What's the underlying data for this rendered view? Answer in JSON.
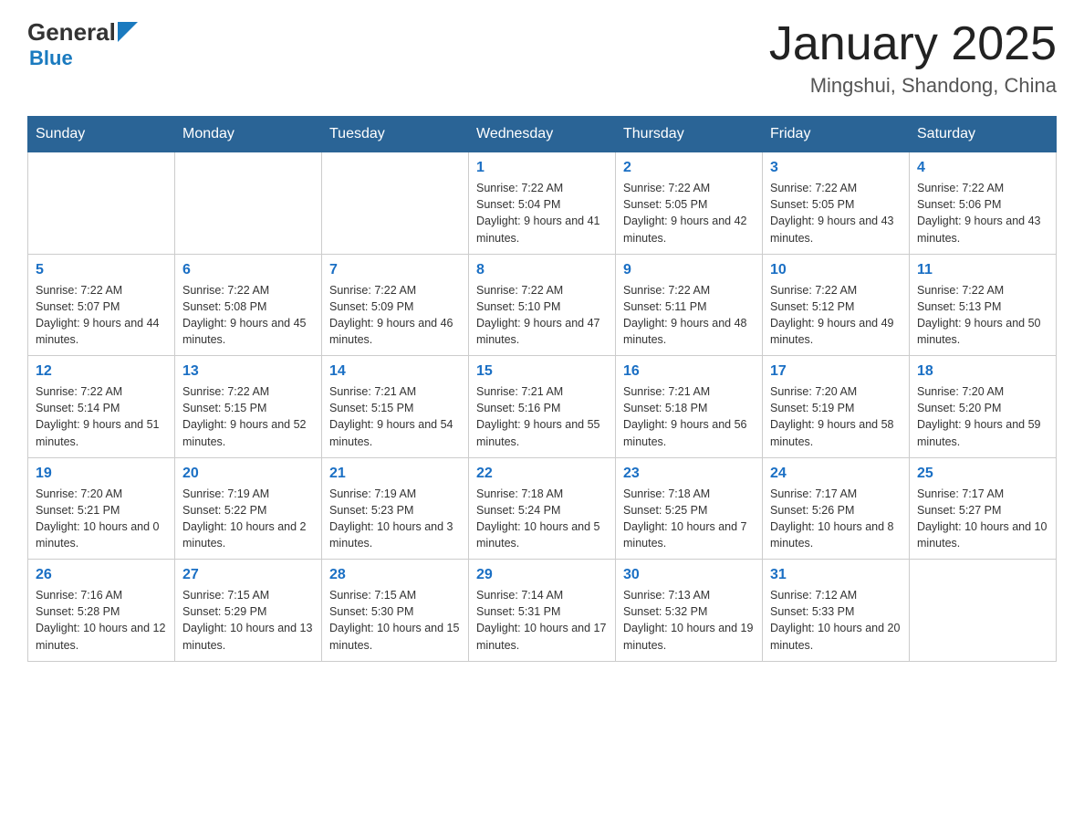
{
  "logo": {
    "general": "General",
    "blue": "Blue",
    "line2": "Blue"
  },
  "header": {
    "title": "January 2025",
    "subtitle": "Mingshui, Shandong, China"
  },
  "days_of_week": [
    "Sunday",
    "Monday",
    "Tuesday",
    "Wednesday",
    "Thursday",
    "Friday",
    "Saturday"
  ],
  "weeks": [
    [
      {
        "day": "",
        "info": ""
      },
      {
        "day": "",
        "info": ""
      },
      {
        "day": "",
        "info": ""
      },
      {
        "day": "1",
        "info": "Sunrise: 7:22 AM\nSunset: 5:04 PM\nDaylight: 9 hours and 41 minutes."
      },
      {
        "day": "2",
        "info": "Sunrise: 7:22 AM\nSunset: 5:05 PM\nDaylight: 9 hours and 42 minutes."
      },
      {
        "day": "3",
        "info": "Sunrise: 7:22 AM\nSunset: 5:05 PM\nDaylight: 9 hours and 43 minutes."
      },
      {
        "day": "4",
        "info": "Sunrise: 7:22 AM\nSunset: 5:06 PM\nDaylight: 9 hours and 43 minutes."
      }
    ],
    [
      {
        "day": "5",
        "info": "Sunrise: 7:22 AM\nSunset: 5:07 PM\nDaylight: 9 hours and 44 minutes."
      },
      {
        "day": "6",
        "info": "Sunrise: 7:22 AM\nSunset: 5:08 PM\nDaylight: 9 hours and 45 minutes."
      },
      {
        "day": "7",
        "info": "Sunrise: 7:22 AM\nSunset: 5:09 PM\nDaylight: 9 hours and 46 minutes."
      },
      {
        "day": "8",
        "info": "Sunrise: 7:22 AM\nSunset: 5:10 PM\nDaylight: 9 hours and 47 minutes."
      },
      {
        "day": "9",
        "info": "Sunrise: 7:22 AM\nSunset: 5:11 PM\nDaylight: 9 hours and 48 minutes."
      },
      {
        "day": "10",
        "info": "Sunrise: 7:22 AM\nSunset: 5:12 PM\nDaylight: 9 hours and 49 minutes."
      },
      {
        "day": "11",
        "info": "Sunrise: 7:22 AM\nSunset: 5:13 PM\nDaylight: 9 hours and 50 minutes."
      }
    ],
    [
      {
        "day": "12",
        "info": "Sunrise: 7:22 AM\nSunset: 5:14 PM\nDaylight: 9 hours and 51 minutes."
      },
      {
        "day": "13",
        "info": "Sunrise: 7:22 AM\nSunset: 5:15 PM\nDaylight: 9 hours and 52 minutes."
      },
      {
        "day": "14",
        "info": "Sunrise: 7:21 AM\nSunset: 5:15 PM\nDaylight: 9 hours and 54 minutes."
      },
      {
        "day": "15",
        "info": "Sunrise: 7:21 AM\nSunset: 5:16 PM\nDaylight: 9 hours and 55 minutes."
      },
      {
        "day": "16",
        "info": "Sunrise: 7:21 AM\nSunset: 5:18 PM\nDaylight: 9 hours and 56 minutes."
      },
      {
        "day": "17",
        "info": "Sunrise: 7:20 AM\nSunset: 5:19 PM\nDaylight: 9 hours and 58 minutes."
      },
      {
        "day": "18",
        "info": "Sunrise: 7:20 AM\nSunset: 5:20 PM\nDaylight: 9 hours and 59 minutes."
      }
    ],
    [
      {
        "day": "19",
        "info": "Sunrise: 7:20 AM\nSunset: 5:21 PM\nDaylight: 10 hours and 0 minutes."
      },
      {
        "day": "20",
        "info": "Sunrise: 7:19 AM\nSunset: 5:22 PM\nDaylight: 10 hours and 2 minutes."
      },
      {
        "day": "21",
        "info": "Sunrise: 7:19 AM\nSunset: 5:23 PM\nDaylight: 10 hours and 3 minutes."
      },
      {
        "day": "22",
        "info": "Sunrise: 7:18 AM\nSunset: 5:24 PM\nDaylight: 10 hours and 5 minutes."
      },
      {
        "day": "23",
        "info": "Sunrise: 7:18 AM\nSunset: 5:25 PM\nDaylight: 10 hours and 7 minutes."
      },
      {
        "day": "24",
        "info": "Sunrise: 7:17 AM\nSunset: 5:26 PM\nDaylight: 10 hours and 8 minutes."
      },
      {
        "day": "25",
        "info": "Sunrise: 7:17 AM\nSunset: 5:27 PM\nDaylight: 10 hours and 10 minutes."
      }
    ],
    [
      {
        "day": "26",
        "info": "Sunrise: 7:16 AM\nSunset: 5:28 PM\nDaylight: 10 hours and 12 minutes."
      },
      {
        "day": "27",
        "info": "Sunrise: 7:15 AM\nSunset: 5:29 PM\nDaylight: 10 hours and 13 minutes."
      },
      {
        "day": "28",
        "info": "Sunrise: 7:15 AM\nSunset: 5:30 PM\nDaylight: 10 hours and 15 minutes."
      },
      {
        "day": "29",
        "info": "Sunrise: 7:14 AM\nSunset: 5:31 PM\nDaylight: 10 hours and 17 minutes."
      },
      {
        "day": "30",
        "info": "Sunrise: 7:13 AM\nSunset: 5:32 PM\nDaylight: 10 hours and 19 minutes."
      },
      {
        "day": "31",
        "info": "Sunrise: 7:12 AM\nSunset: 5:33 PM\nDaylight: 10 hours and 20 minutes."
      },
      {
        "day": "",
        "info": ""
      }
    ]
  ]
}
